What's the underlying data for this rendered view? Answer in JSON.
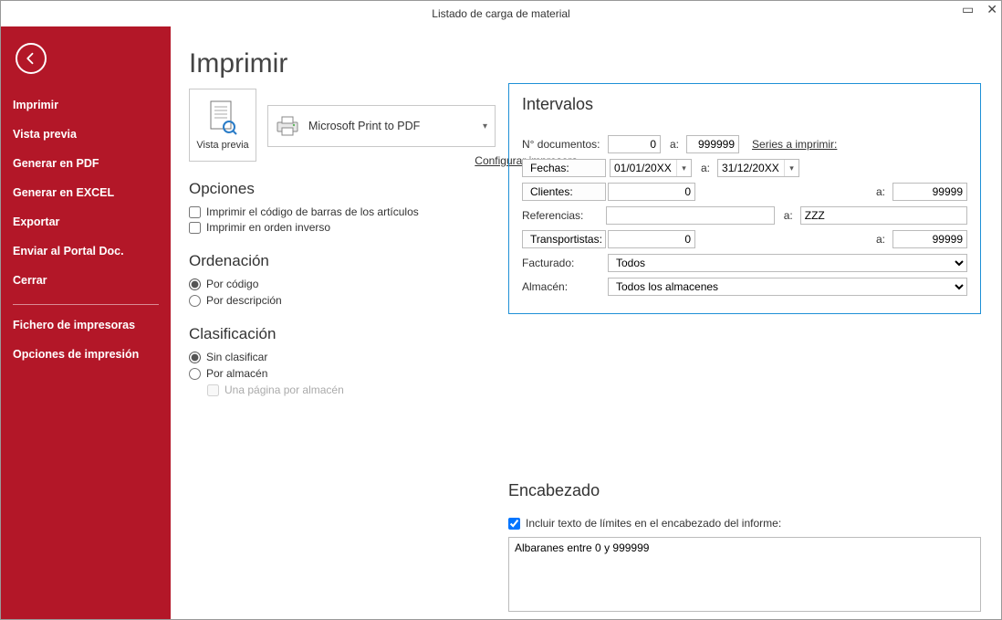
{
  "window": {
    "title": "Listado de carga de material"
  },
  "sidebar": {
    "items": [
      "Imprimir",
      "Vista previa",
      "Generar en PDF",
      "Generar en EXCEL",
      "Exportar",
      "Enviar al Portal Doc.",
      "Cerrar"
    ],
    "items2": [
      "Fichero de impresoras",
      "Opciones de impresión"
    ]
  },
  "main": {
    "heading": "Imprimir",
    "preview_label": "Vista previa",
    "printer_name": "Microsoft Print to PDF",
    "config_link": "Configurar impresora",
    "sections": {
      "options_h": "Opciones",
      "opt_barcode": "Imprimir el código de barras de los artículos",
      "opt_reverse": "Imprimir en orden inverso",
      "order_h": "Ordenación",
      "order_code": "Por código",
      "order_desc": "Por descripción",
      "class_h": "Clasificación",
      "class_none": "Sin clasificar",
      "class_store": "Por almacén",
      "class_page": "Una página por almacén"
    }
  },
  "intervals": {
    "heading": "Intervalos",
    "labels": {
      "docs": "N° documentos:",
      "dates_btn": "Fechas:",
      "clients_btn": "Clientes:",
      "refs": "Referencias:",
      "carriers_btn": "Transportistas:",
      "invoiced": "Facturado:",
      "warehouse": "Almacén:",
      "a": "a:"
    },
    "values": {
      "doc_from": "0",
      "doc_to": "999999",
      "series_link": "Series a imprimir:",
      "date_from": "01/01/20XX",
      "date_to": "31/12/20XX",
      "client_from": "0",
      "client_to": "99999",
      "ref_from": "",
      "ref_to": "ZZZ",
      "carrier_from": "0",
      "carrier_to": "99999",
      "invoiced_sel": "Todos",
      "warehouse_sel": "Todos los almacenes"
    }
  },
  "encab": {
    "heading": "Encabezado",
    "chk": "Incluir texto de límites en el encabezado del informe:",
    "text": "Albaranes entre 0 y 999999"
  }
}
